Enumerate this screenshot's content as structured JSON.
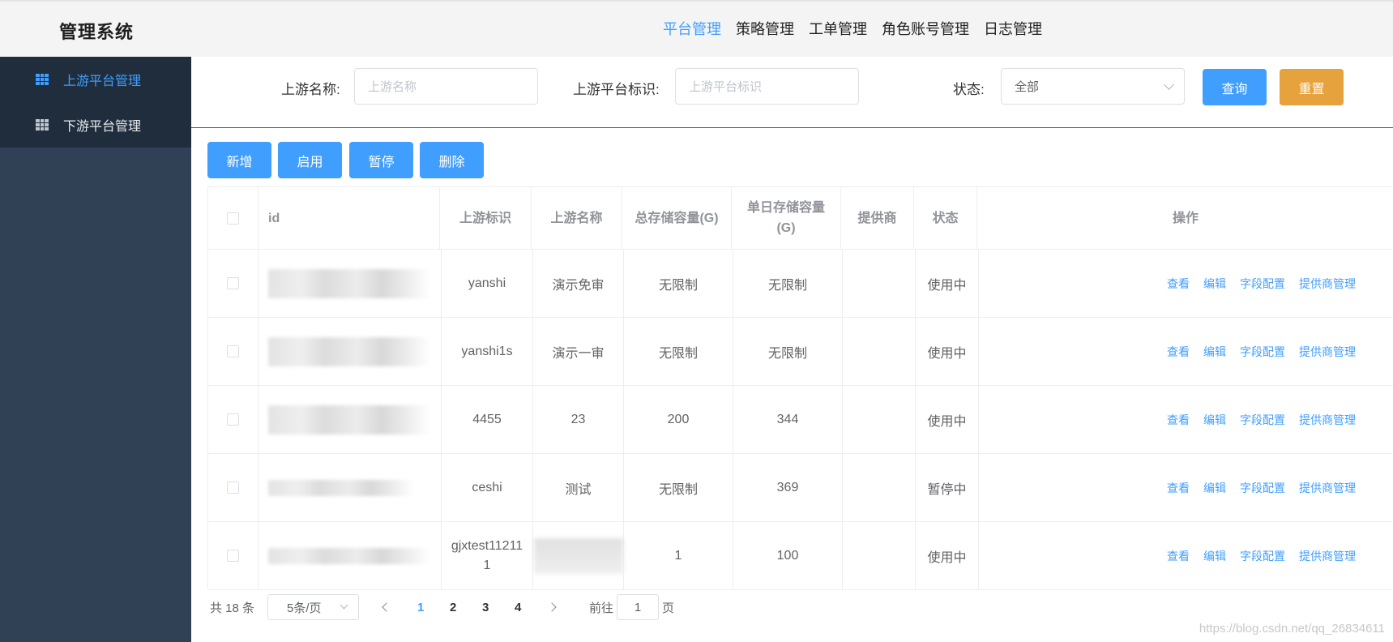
{
  "app": {
    "title": "管理系统"
  },
  "topnav": {
    "items": [
      {
        "label": "平台管理",
        "active": true
      },
      {
        "label": "策略管理",
        "active": false
      },
      {
        "label": "工单管理",
        "active": false
      },
      {
        "label": "角色账号管理",
        "active": false
      },
      {
        "label": "日志管理",
        "active": false
      }
    ]
  },
  "sidebar": {
    "items": [
      {
        "label": "上游平台管理",
        "icon": "table-grid-icon",
        "active": true
      },
      {
        "label": "下游平台管理",
        "icon": "table-grid-icon",
        "active": false
      }
    ]
  },
  "filters": {
    "name_label": "上游名称:",
    "name_placeholder": "上游名称",
    "code_label": "上游平台标识:",
    "code_placeholder": "上游平台标识",
    "status_label": "状态:",
    "status_value": "全部",
    "query_label": "查询",
    "reset_label": "重置"
  },
  "actions": {
    "add": "新增",
    "enable": "启用",
    "pause": "暂停",
    "delete": "删除"
  },
  "table": {
    "headers": [
      "id",
      "上游标识",
      "上游名称",
      "总存储容量(G)",
      "单日存储容量(G)",
      "提供商",
      "状态",
      "操作"
    ],
    "rows": [
      {
        "code": "yanshi",
        "name": "演示免审",
        "total": "无限制",
        "daily": "无限制",
        "provider": "",
        "status": "使用中"
      },
      {
        "code": "yanshi1s",
        "name": "演示一审",
        "total": "无限制",
        "daily": "无限制",
        "provider": "",
        "status": "使用中"
      },
      {
        "code": "4455",
        "name": "23",
        "total": "200",
        "daily": "344",
        "provider": "",
        "status": "使用中"
      },
      {
        "code": "ceshi",
        "name": "测试",
        "total": "无限制",
        "daily": "369",
        "provider": "",
        "status": "暂停中"
      },
      {
        "code": "gjxtest112111",
        "name": "",
        "total": "1",
        "daily": "100",
        "provider": "",
        "status": "使用中"
      }
    ],
    "ops": [
      "查看",
      "编辑",
      "字段配置",
      "提供商管理"
    ]
  },
  "pagination": {
    "total": "共 18 条",
    "page_size": "5条/页",
    "pages": [
      "1",
      "2",
      "3",
      "4"
    ],
    "current": "1",
    "goto_label": "前往",
    "goto_value": "1",
    "page_suffix": "页"
  },
  "watermark": "https://blog.csdn.net/qq_26834611",
  "colors": {
    "primary": "#409eff",
    "warning": "#e6a23c",
    "sidebar": "#304156"
  }
}
